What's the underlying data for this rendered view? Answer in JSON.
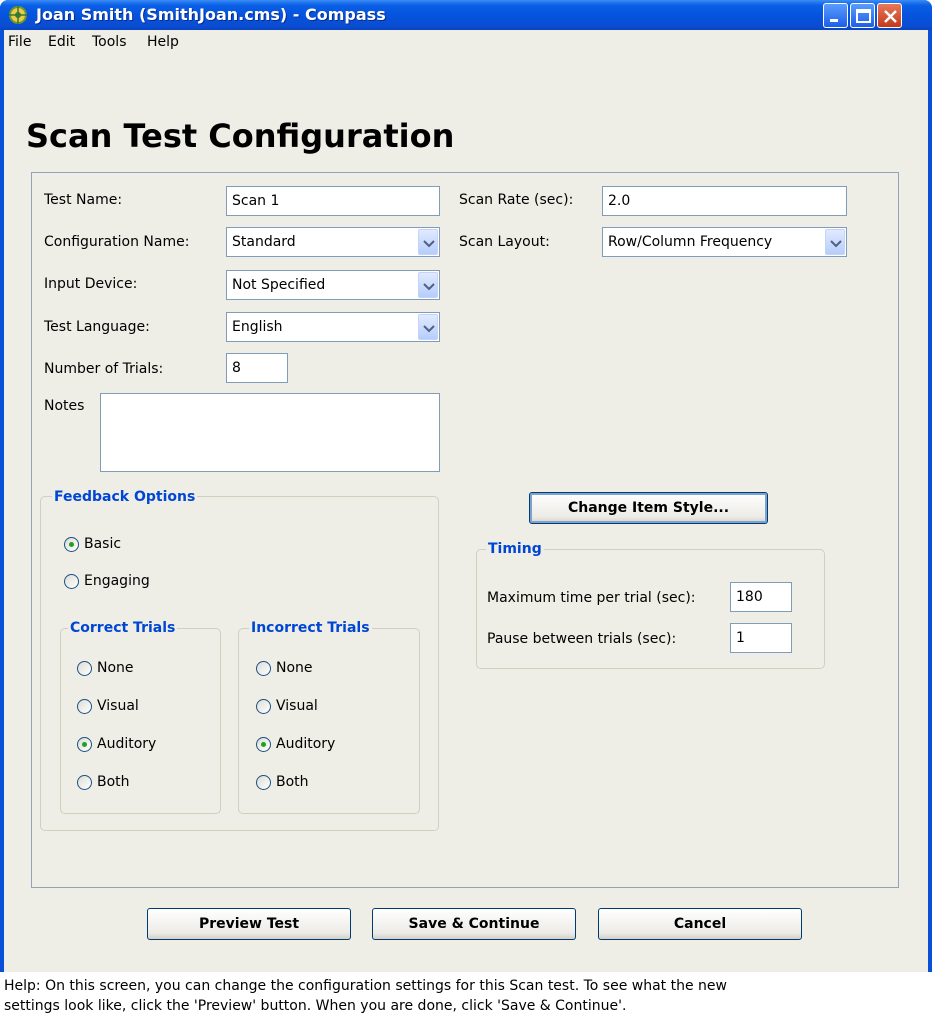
{
  "window": {
    "title": "Joan Smith (SmithJoan.cms) - Compass"
  },
  "menu": [
    "File",
    "Edit",
    "Tools",
    "Help"
  ],
  "page_title": "Scan Test Configuration",
  "form": {
    "test_name": {
      "label": "Test Name:",
      "value": "Scan 1"
    },
    "configuration_name": {
      "label": "Configuration Name:",
      "value": "Standard"
    },
    "input_device": {
      "label": "Input Device:",
      "value": "Not Specified"
    },
    "test_language": {
      "label": "Test Language:",
      "value": "English"
    },
    "number_of_trials": {
      "label": "Number of Trials:",
      "value": "8"
    },
    "notes": {
      "label": "Notes",
      "value": ""
    },
    "scan_rate": {
      "label": "Scan Rate (sec):",
      "value": "2.0"
    },
    "scan_layout": {
      "label": "Scan Layout:",
      "value": "Row/Column Frequency"
    }
  },
  "feedback": {
    "title": "Feedback Options",
    "options": [
      "Basic",
      "Engaging"
    ],
    "selected": "Basic",
    "correct": {
      "title": "Correct Trials",
      "options": [
        "None",
        "Visual",
        "Auditory",
        "Both"
      ],
      "selected": "Auditory"
    },
    "incorrect": {
      "title": "Incorrect Trials",
      "options": [
        "None",
        "Visual",
        "Auditory",
        "Both"
      ],
      "selected": "Auditory"
    }
  },
  "change_item_style_label": "Change Item Style...",
  "timing": {
    "title": "Timing",
    "max_time": {
      "label": "Maximum time per trial (sec):",
      "value": "180"
    },
    "pause": {
      "label": "Pause between trials (sec):",
      "value": "1"
    }
  },
  "buttons": {
    "preview": "Preview Test",
    "save": "Save & Continue",
    "cancel": "Cancel"
  },
  "help_text_line1": "Help:  On this screen, you can change the configuration settings for this Scan test.  To see what the new",
  "help_text_line2": "settings look like, click the 'Preview' button.  When you are done, click 'Save & Continue'.",
  "colors": {
    "titlebar": "#0552db",
    "group_title": "#0046d5",
    "window_bg": "#eeeee6",
    "close_button": "#c3391a"
  },
  "icons": [
    "compass-app-icon",
    "minimize-icon",
    "maximize-icon",
    "close-icon",
    "dropdown-arrow-icon"
  ]
}
